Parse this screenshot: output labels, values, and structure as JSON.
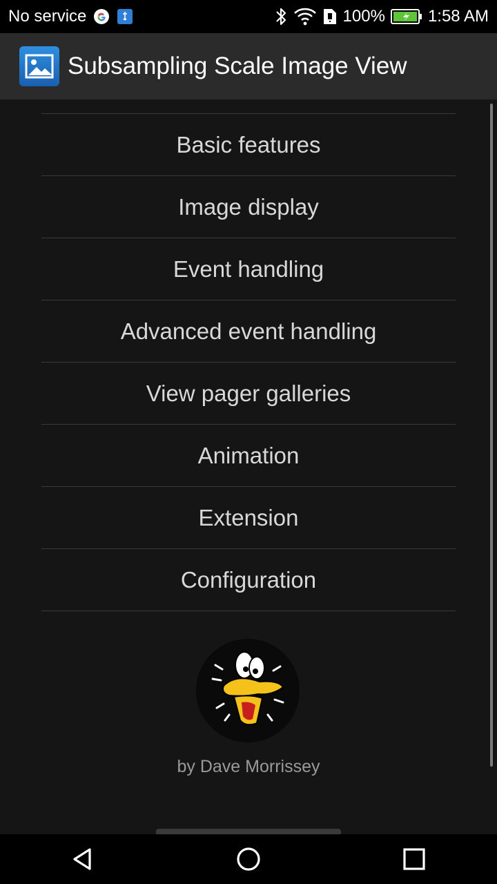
{
  "status_bar": {
    "carrier": "No service",
    "battery_percent": "100%",
    "time": "1:58 AM",
    "icons": [
      "google-icon",
      "usb-icon",
      "bluetooth-icon",
      "wifi-icon",
      "sim-icon",
      "battery-icon"
    ]
  },
  "app_bar": {
    "title": "Subsampling Scale Image View",
    "icon": "image-icon"
  },
  "menu": {
    "items": [
      {
        "label": "Basic features"
      },
      {
        "label": "Image display"
      },
      {
        "label": "Event handling"
      },
      {
        "label": "Advanced event handling"
      },
      {
        "label": "View pager galleries"
      },
      {
        "label": "Animation"
      },
      {
        "label": "Extension"
      },
      {
        "label": "Configuration"
      }
    ]
  },
  "footer": {
    "byline": "by Dave Morrissey",
    "avatar": "duck-avatar"
  },
  "nav_bar": {
    "buttons": [
      "back-icon",
      "home-icon",
      "recents-icon"
    ]
  },
  "colors": {
    "background": "#151515",
    "app_bar": "#2b2b2b",
    "text": "#d8d8d8",
    "divider": "#3a3a3a"
  }
}
